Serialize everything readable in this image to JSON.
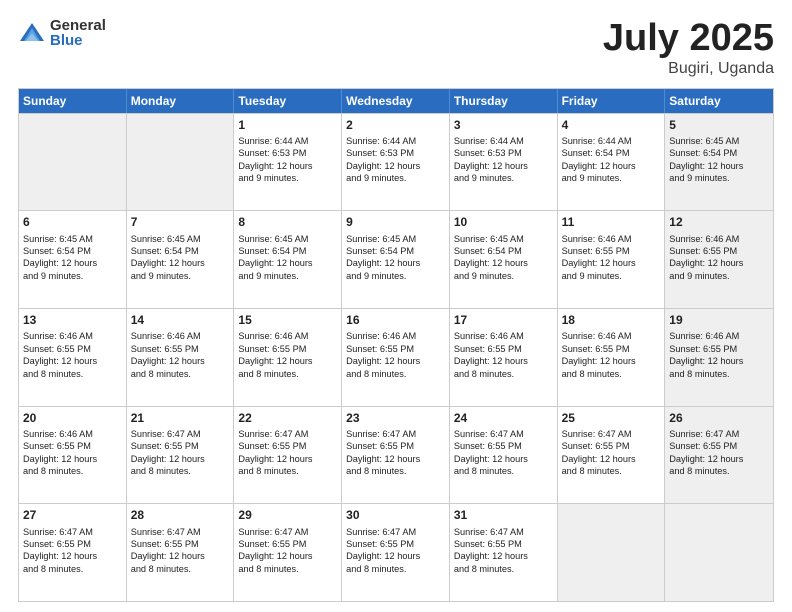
{
  "logo": {
    "general": "General",
    "blue": "Blue"
  },
  "title": {
    "month": "July 2025",
    "location": "Bugiri, Uganda"
  },
  "header_days": [
    "Sunday",
    "Monday",
    "Tuesday",
    "Wednesday",
    "Thursday",
    "Friday",
    "Saturday"
  ],
  "weeks": [
    [
      {
        "day": "",
        "info": "",
        "shaded": true
      },
      {
        "day": "",
        "info": "",
        "shaded": true
      },
      {
        "day": "1",
        "info": "Sunrise: 6:44 AM\nSunset: 6:53 PM\nDaylight: 12 hours\nand 9 minutes."
      },
      {
        "day": "2",
        "info": "Sunrise: 6:44 AM\nSunset: 6:53 PM\nDaylight: 12 hours\nand 9 minutes."
      },
      {
        "day": "3",
        "info": "Sunrise: 6:44 AM\nSunset: 6:53 PM\nDaylight: 12 hours\nand 9 minutes."
      },
      {
        "day": "4",
        "info": "Sunrise: 6:44 AM\nSunset: 6:54 PM\nDaylight: 12 hours\nand 9 minutes."
      },
      {
        "day": "5",
        "info": "Sunrise: 6:45 AM\nSunset: 6:54 PM\nDaylight: 12 hours\nand 9 minutes.",
        "shaded": true
      }
    ],
    [
      {
        "day": "6",
        "info": "Sunrise: 6:45 AM\nSunset: 6:54 PM\nDaylight: 12 hours\nand 9 minutes."
      },
      {
        "day": "7",
        "info": "Sunrise: 6:45 AM\nSunset: 6:54 PM\nDaylight: 12 hours\nand 9 minutes."
      },
      {
        "day": "8",
        "info": "Sunrise: 6:45 AM\nSunset: 6:54 PM\nDaylight: 12 hours\nand 9 minutes."
      },
      {
        "day": "9",
        "info": "Sunrise: 6:45 AM\nSunset: 6:54 PM\nDaylight: 12 hours\nand 9 minutes."
      },
      {
        "day": "10",
        "info": "Sunrise: 6:45 AM\nSunset: 6:54 PM\nDaylight: 12 hours\nand 9 minutes."
      },
      {
        "day": "11",
        "info": "Sunrise: 6:46 AM\nSunset: 6:55 PM\nDaylight: 12 hours\nand 9 minutes."
      },
      {
        "day": "12",
        "info": "Sunrise: 6:46 AM\nSunset: 6:55 PM\nDaylight: 12 hours\nand 9 minutes.",
        "shaded": true
      }
    ],
    [
      {
        "day": "13",
        "info": "Sunrise: 6:46 AM\nSunset: 6:55 PM\nDaylight: 12 hours\nand 8 minutes."
      },
      {
        "day": "14",
        "info": "Sunrise: 6:46 AM\nSunset: 6:55 PM\nDaylight: 12 hours\nand 8 minutes."
      },
      {
        "day": "15",
        "info": "Sunrise: 6:46 AM\nSunset: 6:55 PM\nDaylight: 12 hours\nand 8 minutes."
      },
      {
        "day": "16",
        "info": "Sunrise: 6:46 AM\nSunset: 6:55 PM\nDaylight: 12 hours\nand 8 minutes."
      },
      {
        "day": "17",
        "info": "Sunrise: 6:46 AM\nSunset: 6:55 PM\nDaylight: 12 hours\nand 8 minutes."
      },
      {
        "day": "18",
        "info": "Sunrise: 6:46 AM\nSunset: 6:55 PM\nDaylight: 12 hours\nand 8 minutes."
      },
      {
        "day": "19",
        "info": "Sunrise: 6:46 AM\nSunset: 6:55 PM\nDaylight: 12 hours\nand 8 minutes.",
        "shaded": true
      }
    ],
    [
      {
        "day": "20",
        "info": "Sunrise: 6:46 AM\nSunset: 6:55 PM\nDaylight: 12 hours\nand 8 minutes."
      },
      {
        "day": "21",
        "info": "Sunrise: 6:47 AM\nSunset: 6:55 PM\nDaylight: 12 hours\nand 8 minutes."
      },
      {
        "day": "22",
        "info": "Sunrise: 6:47 AM\nSunset: 6:55 PM\nDaylight: 12 hours\nand 8 minutes."
      },
      {
        "day": "23",
        "info": "Sunrise: 6:47 AM\nSunset: 6:55 PM\nDaylight: 12 hours\nand 8 minutes."
      },
      {
        "day": "24",
        "info": "Sunrise: 6:47 AM\nSunset: 6:55 PM\nDaylight: 12 hours\nand 8 minutes."
      },
      {
        "day": "25",
        "info": "Sunrise: 6:47 AM\nSunset: 6:55 PM\nDaylight: 12 hours\nand 8 minutes."
      },
      {
        "day": "26",
        "info": "Sunrise: 6:47 AM\nSunset: 6:55 PM\nDaylight: 12 hours\nand 8 minutes.",
        "shaded": true
      }
    ],
    [
      {
        "day": "27",
        "info": "Sunrise: 6:47 AM\nSunset: 6:55 PM\nDaylight: 12 hours\nand 8 minutes."
      },
      {
        "day": "28",
        "info": "Sunrise: 6:47 AM\nSunset: 6:55 PM\nDaylight: 12 hours\nand 8 minutes."
      },
      {
        "day": "29",
        "info": "Sunrise: 6:47 AM\nSunset: 6:55 PM\nDaylight: 12 hours\nand 8 minutes."
      },
      {
        "day": "30",
        "info": "Sunrise: 6:47 AM\nSunset: 6:55 PM\nDaylight: 12 hours\nand 8 minutes."
      },
      {
        "day": "31",
        "info": "Sunrise: 6:47 AM\nSunset: 6:55 PM\nDaylight: 12 hours\nand 8 minutes."
      },
      {
        "day": "",
        "info": "",
        "shaded": true
      },
      {
        "day": "",
        "info": "",
        "shaded": true
      }
    ]
  ]
}
